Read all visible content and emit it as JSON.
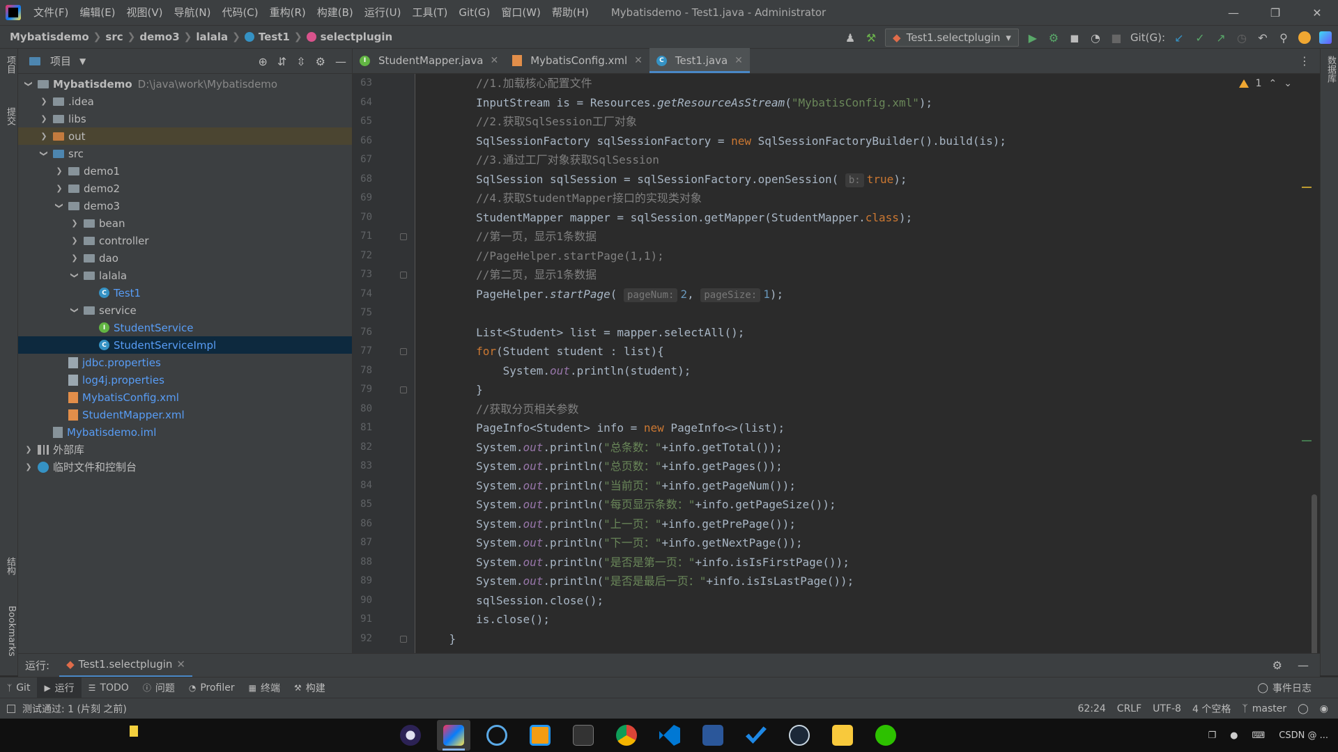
{
  "menu": {
    "items": [
      "文件(F)",
      "编辑(E)",
      "视图(V)",
      "导航(N)",
      "代码(C)",
      "重构(R)",
      "构建(B)",
      "运行(U)",
      "工具(T)",
      "Git(G)",
      "窗口(W)",
      "帮助(H)"
    ],
    "window_title": "Mybatisdemo - Test1.java - Administrator"
  },
  "breadcrumb": {
    "project": "Mybatisdemo",
    "parts": [
      "src",
      "demo3",
      "lalala"
    ],
    "class": "Test1",
    "method": "selectplugin"
  },
  "toolbar": {
    "run_config": "Test1.selectplugin",
    "git_label": "Git(G):"
  },
  "left_strip": {
    "project_tab": "项目",
    "commit_tab": "提交",
    "structure_tab": "结构",
    "bookmarks_tab": "Bookmarks"
  },
  "right_strip": {
    "database_tab": "数据库"
  },
  "project_panel": {
    "title": "项目",
    "tree": [
      {
        "label": "Mybatisdemo",
        "path": "D:\\java\\work\\Mybatisdemo",
        "indent": 0,
        "expanded": true,
        "icon": "module-folder",
        "bold": true
      },
      {
        "label": ".idea",
        "indent": 1,
        "expanded": false,
        "icon": "folder"
      },
      {
        "label": "libs",
        "indent": 1,
        "expanded": false,
        "icon": "folder"
      },
      {
        "label": "out",
        "indent": 1,
        "expanded": false,
        "icon": "folder-orange",
        "highlight": true
      },
      {
        "label": "src",
        "indent": 1,
        "expanded": true,
        "icon": "folder-blue"
      },
      {
        "label": "demo1",
        "indent": 2,
        "expanded": false,
        "icon": "package"
      },
      {
        "label": "demo2",
        "indent": 2,
        "expanded": false,
        "icon": "package"
      },
      {
        "label": "demo3",
        "indent": 2,
        "expanded": true,
        "icon": "package"
      },
      {
        "label": "bean",
        "indent": 3,
        "expanded": false,
        "icon": "package"
      },
      {
        "label": "controller",
        "indent": 3,
        "expanded": false,
        "icon": "package"
      },
      {
        "label": "dao",
        "indent": 3,
        "expanded": false,
        "icon": "package"
      },
      {
        "label": "lalala",
        "indent": 3,
        "expanded": true,
        "icon": "package"
      },
      {
        "label": "Test1",
        "indent": 4,
        "icon": "class",
        "color": "blue"
      },
      {
        "label": "service",
        "indent": 3,
        "expanded": true,
        "icon": "package"
      },
      {
        "label": "StudentService",
        "indent": 4,
        "icon": "interface",
        "color": "blue"
      },
      {
        "label": "StudentServiceImpl",
        "indent": 4,
        "icon": "class",
        "color": "blue",
        "selected": true
      },
      {
        "label": "jdbc.properties",
        "indent": 2,
        "icon": "properties",
        "color": "blue"
      },
      {
        "label": "log4j.properties",
        "indent": 2,
        "icon": "properties",
        "color": "blue"
      },
      {
        "label": "MybatisConfig.xml",
        "indent": 2,
        "icon": "xml",
        "color": "blue"
      },
      {
        "label": "StudentMapper.xml",
        "indent": 2,
        "icon": "xml",
        "color": "blue"
      },
      {
        "label": "Mybatisdemo.iml",
        "indent": 1,
        "icon": "iml",
        "color": "blue"
      },
      {
        "label": "外部库",
        "indent": 0,
        "expanded": false,
        "icon": "library"
      },
      {
        "label": "临时文件和控制台",
        "indent": 0,
        "expanded": false,
        "icon": "scratch"
      }
    ]
  },
  "editor": {
    "tabs": [
      {
        "label": "StudentMapper.java",
        "icon": "interface",
        "active": false
      },
      {
        "label": "MybatisConfig.xml",
        "icon": "xml",
        "active": false
      },
      {
        "label": "Test1.java",
        "icon": "class",
        "active": true
      }
    ],
    "warning_count": "1",
    "lines": [
      {
        "no": "63",
        "html": "        <span class='c-comment'>//1.加载核心配置文件</span>"
      },
      {
        "no": "64",
        "html": "        InputStream is = Resources.<span class='c-ital'>getResourceAsStream</span>(<span class='c-str'>\"MybatisConfig.xml\"</span>);"
      },
      {
        "no": "65",
        "html": "        <span class='c-comment'>//2.获取SqlSession工厂对象</span>"
      },
      {
        "no": "66",
        "html": "        SqlSessionFactory sqlSessionFactory = <span class='c-kw'>new</span> SqlSessionFactoryBuilder().build(is);"
      },
      {
        "no": "67",
        "html": "        <span class='c-comment'>//3.通过工厂对象获取SqlSession</span>"
      },
      {
        "no": "68",
        "html": "        SqlSession sqlSession = sqlSessionFactory.openSession( <span class='hint'>b:</span><span class='c-kw'>true</span>);"
      },
      {
        "no": "69",
        "html": "        <span class='c-comment'>//4.获取StudentMapper接口的实现类对象</span>"
      },
      {
        "no": "70",
        "html": "        StudentMapper mapper = sqlSession.getMapper(StudentMapper.<span class='c-kw'>class</span>);"
      },
      {
        "no": "71",
        "html": "        <span class='c-comment'>//第一页，显示1条数据</span>"
      },
      {
        "no": "72",
        "html": "        <span class='c-comment'>//PageHelper.startPage(1,1);</span>"
      },
      {
        "no": "73",
        "html": "        <span class='c-comment'>//第二页，显示1条数据</span>"
      },
      {
        "no": "74",
        "html": "        PageHelper.<span class='c-ital'>startPage</span>( <span class='hint'>pageNum:</span><span class='c-num'>2</span>, <span class='hint'>pageSize:</span><span class='c-num'>1</span>);"
      },
      {
        "no": "75",
        "html": ""
      },
      {
        "no": "76",
        "html": "        List&lt;Student&gt; list = mapper.selectAll();"
      },
      {
        "no": "77",
        "html": "        <span class='c-kw'>for</span>(Student student : list){"
      },
      {
        "no": "78",
        "html": "            System.<span class='c-field'>out</span>.println(student);"
      },
      {
        "no": "79",
        "html": "        }"
      },
      {
        "no": "80",
        "html": "        <span class='c-comment'>//获取分页相关参数</span>"
      },
      {
        "no": "81",
        "html": "        PageInfo&lt;Student&gt; info = <span class='c-kw'>new</span> PageInfo&lt;&gt;(list);"
      },
      {
        "no": "82",
        "html": "        System.<span class='c-field'>out</span>.println(<span class='c-str'>\"总条数：\"</span>+info.getTotal());"
      },
      {
        "no": "83",
        "html": "        System.<span class='c-field'>out</span>.println(<span class='c-str'>\"总页数：\"</span>+info.getPages());"
      },
      {
        "no": "84",
        "html": "        System.<span class='c-field'>out</span>.println(<span class='c-str'>\"当前页：\"</span>+info.getPageNum());"
      },
      {
        "no": "85",
        "html": "        System.<span class='c-field'>out</span>.println(<span class='c-str'>\"每页显示条数：\"</span>+info.getPageSize());"
      },
      {
        "no": "86",
        "html": "        System.<span class='c-field'>out</span>.println(<span class='c-str'>\"上一页：\"</span>+info.getPrePage());"
      },
      {
        "no": "87",
        "html": "        System.<span class='c-field'>out</span>.println(<span class='c-str'>\"下一页：\"</span>+info.getNextPage());"
      },
      {
        "no": "88",
        "html": "        System.<span class='c-field'>out</span>.println(<span class='c-str'>\"是否是第一页：\"</span>+info.isIsFirstPage());"
      },
      {
        "no": "89",
        "html": "        System.<span class='c-field'>out</span>.println(<span class='c-str'>\"是否是最后一页：\"</span>+info.isIsLastPage());"
      },
      {
        "no": "90",
        "html": "        sqlSession.close();"
      },
      {
        "no": "91",
        "html": "        is.close();"
      },
      {
        "no": "92",
        "html": "    }"
      }
    ]
  },
  "run_panel": {
    "label": "运行:",
    "tab": "Test1.selectplugin"
  },
  "tool_tabs": {
    "items": [
      "Git",
      "运行",
      "TODO",
      "问题",
      "Profiler",
      "终端",
      "构建"
    ],
    "event_log": "事件日志"
  },
  "status": {
    "message": "测试通过: 1 (片刻 之前)",
    "position": "62:24",
    "line_sep": "CRLF",
    "encoding": "UTF-8",
    "indent": "4 个空格",
    "branch": "master"
  },
  "taskbar": {
    "watermark": "CSDN @ ..."
  },
  "colors": {
    "accent": "#4a88c7",
    "selection": "#0d293e",
    "keyword": "#cc7832",
    "string": "#6a8759",
    "comment": "#808080"
  }
}
